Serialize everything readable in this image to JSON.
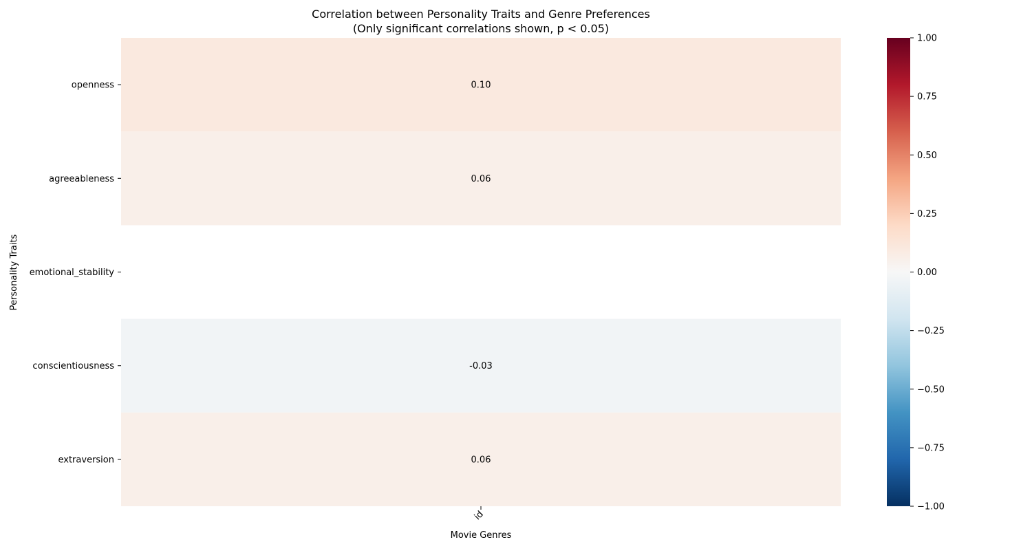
{
  "chart_data": {
    "type": "heatmap",
    "title": "Correlation between Personality Traits and Genre Preferences",
    "subtitle": "(Only significant correlations shown, p < 0.05)",
    "xlabel": "Movie Genres",
    "ylabel": "Personality Traits",
    "columns": [
      "id"
    ],
    "rows": [
      "openness",
      "agreeableness",
      "emotional_stability",
      "conscientiousness",
      "extraversion"
    ],
    "values": [
      [
        0.1
      ],
      [
        0.06
      ],
      [
        null
      ],
      [
        -0.03
      ],
      [
        0.06
      ]
    ],
    "value_labels": [
      [
        "0.10"
      ],
      [
        "0.06"
      ],
      [
        ""
      ],
      [
        "-0.03"
      ],
      [
        "0.06"
      ]
    ],
    "colorbar": {
      "colormap": "RdBu_r",
      "range": [
        -1.0,
        1.0
      ],
      "ticks": [
        1.0,
        0.75,
        0.5,
        0.25,
        0.0,
        -0.25,
        -0.5,
        -0.75,
        -1.0
      ],
      "tick_labels": [
        "1.00",
        "0.75",
        "0.50",
        "0.25",
        "0.00",
        "−0.25",
        "−0.50",
        "−0.75",
        "−1.00"
      ]
    },
    "grid": false,
    "legend": "colorbar-right"
  }
}
